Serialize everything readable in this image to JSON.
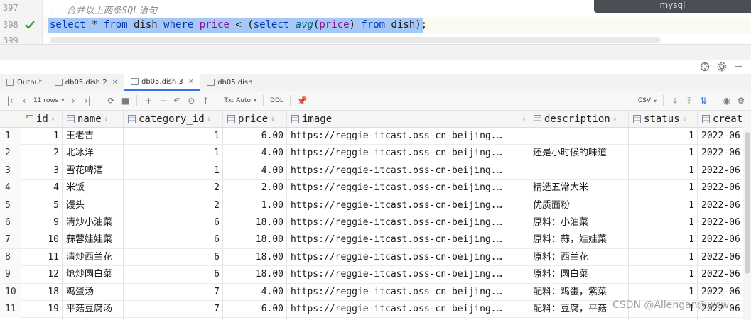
{
  "editor": {
    "line_numbers": [
      "397",
      "398",
      "399"
    ],
    "comment": "-- 合并以上两条SQL语句",
    "sql": {
      "kw_select": "select",
      "star": " * ",
      "kw_from": "from",
      "t1": " dish ",
      "kw_where": "where",
      "col_price": " price ",
      "lt": "< (",
      "kw_select2": "select",
      "fn_avg": " avg",
      "paren_open": "(",
      "col_price2": "price",
      "paren_close": ") ",
      "kw_from2": "from",
      "t2": " dish);"
    },
    "popup": "mysql"
  },
  "tabs": [
    {
      "label": "Output",
      "active": false
    },
    {
      "label": "db05.dish 2",
      "active": false
    },
    {
      "label": "db05.dish 3",
      "active": true
    },
    {
      "label": "db05.dish",
      "active": false
    }
  ],
  "toolbar": {
    "rows": "11 rows",
    "tx": "Tx: Auto",
    "ddl": "DDL",
    "export": "CSV"
  },
  "columns": [
    "id",
    "name",
    "category_id",
    "price",
    "image",
    "description",
    "status",
    "creat"
  ],
  "rows": [
    {
      "n": "1",
      "id": "1",
      "name": "王老吉",
      "cat": "1",
      "price": "6.00",
      "image": "https://reggie-itcast.oss-cn-beijing.…",
      "desc": "",
      "status": "1",
      "created": "2022-06"
    },
    {
      "n": "2",
      "id": "2",
      "name": "北冰洋",
      "cat": "1",
      "price": "4.00",
      "image": "https://reggie-itcast.oss-cn-beijing.…",
      "desc": "还是小时候的味道",
      "status": "1",
      "created": "2022-06"
    },
    {
      "n": "3",
      "id": "3",
      "name": "雪花啤酒",
      "cat": "1",
      "price": "4.00",
      "image": "https://reggie-itcast.oss-cn-beijing.…",
      "desc": "",
      "status": "1",
      "created": "2022-06"
    },
    {
      "n": "4",
      "id": "4",
      "name": "米饭",
      "cat": "2",
      "price": "2.00",
      "image": "https://reggie-itcast.oss-cn-beijing.…",
      "desc": "精选五常大米",
      "status": "1",
      "created": "2022-06"
    },
    {
      "n": "5",
      "id": "5",
      "name": "馒头",
      "cat": "2",
      "price": "1.00",
      "image": "https://reggie-itcast.oss-cn-beijing.…",
      "desc": "优质面粉",
      "status": "1",
      "created": "2022-06"
    },
    {
      "n": "6",
      "id": "9",
      "name": "清炒小油菜",
      "cat": "6",
      "price": "18.00",
      "image": "https://reggie-itcast.oss-cn-beijing.…",
      "desc": "原料：小油菜",
      "status": "1",
      "created": "2022-06"
    },
    {
      "n": "7",
      "id": "10",
      "name": "蒜蓉娃娃菜",
      "cat": "6",
      "price": "18.00",
      "image": "https://reggie-itcast.oss-cn-beijing.…",
      "desc": "原料：蒜，娃娃菜",
      "status": "1",
      "created": "2022-06"
    },
    {
      "n": "8",
      "id": "11",
      "name": "清炒西兰花",
      "cat": "6",
      "price": "18.00",
      "image": "https://reggie-itcast.oss-cn-beijing.…",
      "desc": "原料：西兰花",
      "status": "1",
      "created": "2022-06"
    },
    {
      "n": "9",
      "id": "12",
      "name": "炝炒圆白菜",
      "cat": "6",
      "price": "18.00",
      "image": "https://reggie-itcast.oss-cn-beijing.…",
      "desc": "原料：圆白菜",
      "status": "1",
      "created": "2022-06"
    },
    {
      "n": "10",
      "id": "18",
      "name": "鸡蛋汤",
      "cat": "7",
      "price": "4.00",
      "image": "https://reggie-itcast.oss-cn-beijing.…",
      "desc": "配料：鸡蛋，紫菜",
      "status": "1",
      "created": "2022-06"
    },
    {
      "n": "11",
      "id": "19",
      "name": "平菇豆腐汤",
      "cat": "7",
      "price": "6.00",
      "image": "https://reggie-itcast.oss-cn-beijing.…",
      "desc": "配料：豆腐，平菇",
      "status": "1",
      "created": "2022-06"
    }
  ],
  "watermark": "CSDN @Allengan@wcw",
  "colors": {
    "selection": "#a6c8f7",
    "keyword": "#0033b3",
    "identifier": "#871094",
    "accent": "#3574f0"
  }
}
